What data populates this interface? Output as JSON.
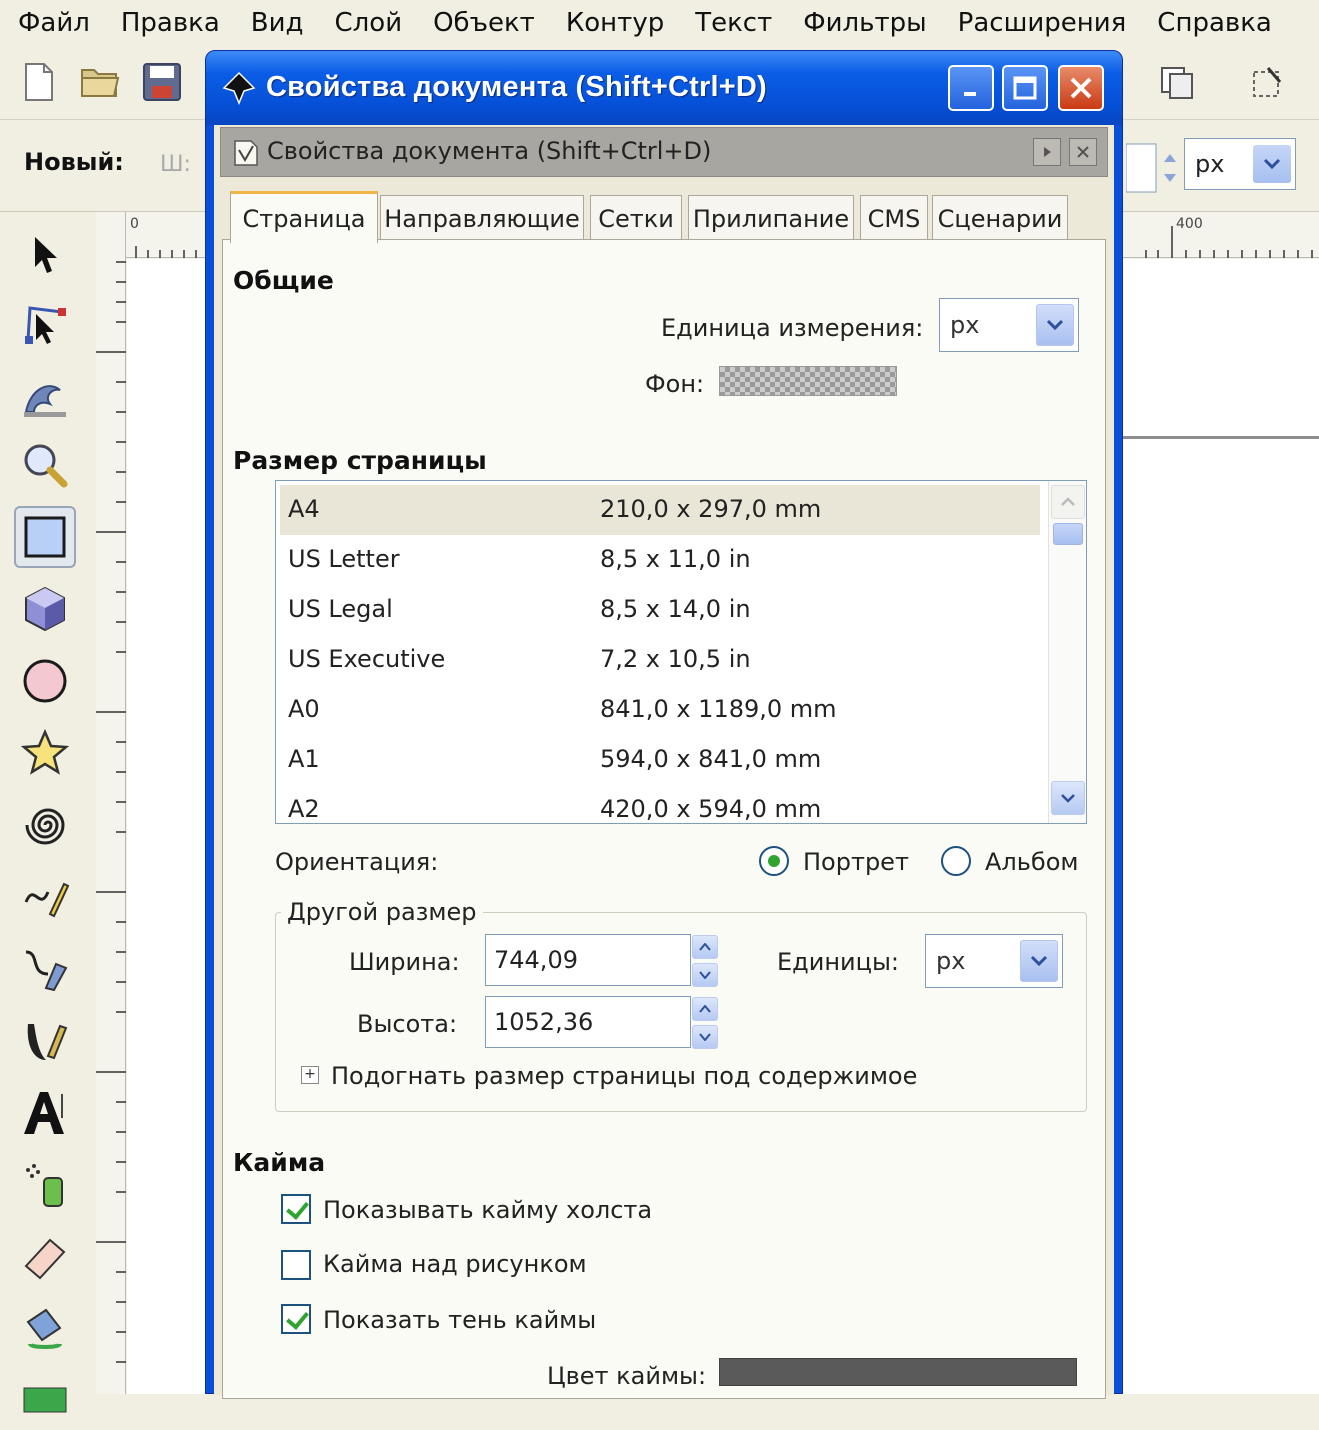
{
  "menu": [
    "Файл",
    "Правка",
    "Вид",
    "Слой",
    "Объект",
    "Контур",
    "Текст",
    "Фильтры",
    "Расширения",
    "Справка"
  ],
  "toolbar2": {
    "new_label": "Новый:",
    "w_label": "Ш:",
    "unit": "px"
  },
  "ruler": {
    "h_zero": "0",
    "h_400": "400"
  },
  "dialog": {
    "window_title": "Свойства документа (Shift+Ctrl+D)",
    "panel_title": "Свойства документа (Shift+Ctrl+D)",
    "tabs": [
      "Страница",
      "Направляющие",
      "Сетки",
      "Прилипание",
      "CMS",
      "Сценарии"
    ],
    "active_tab": "Страница",
    "general": {
      "heading": "Общие",
      "unit_label": "Единица измерения:",
      "unit_value": "px",
      "background_label": "Фон:"
    },
    "page_size": {
      "heading": "Размер страницы",
      "rows": [
        {
          "name": "A4",
          "size": "210,0 x 297,0 mm"
        },
        {
          "name": "US Letter",
          "size": "8,5 x 11,0 in"
        },
        {
          "name": "US Legal",
          "size": "8,5 x 14,0 in"
        },
        {
          "name": "US Executive",
          "size": "7,2 x 10,5 in"
        },
        {
          "name": "A0",
          "size": "841,0 x 1189,0 mm"
        },
        {
          "name": "A1",
          "size": "594,0 x 841,0 mm"
        },
        {
          "name": "A2",
          "size": "420,0 x 594,0 mm"
        }
      ],
      "selected": "A4"
    },
    "orientation": {
      "label": "Ориентация:",
      "portrait": "Портрет",
      "landscape": "Альбом",
      "selected": "portrait"
    },
    "custom_size": {
      "title": "Другой размер",
      "width_label": "Ширина:",
      "width_value": "744,09",
      "height_label": "Высота:",
      "height_value": "1052,36",
      "units_label": "Единицы:",
      "units_value": "px",
      "fit_label": "Подогнать размер страницы под содержимое"
    },
    "border": {
      "heading": "Кайма",
      "show_border": "Показывать кайму холста",
      "show_border_checked": true,
      "border_on_top": "Кайма над рисунком",
      "border_on_top_checked": false,
      "show_shadow": "Показать тень каймы",
      "show_shadow_checked": true,
      "color_label": "Цвет каймы:",
      "color": "#5a5a5a"
    }
  }
}
